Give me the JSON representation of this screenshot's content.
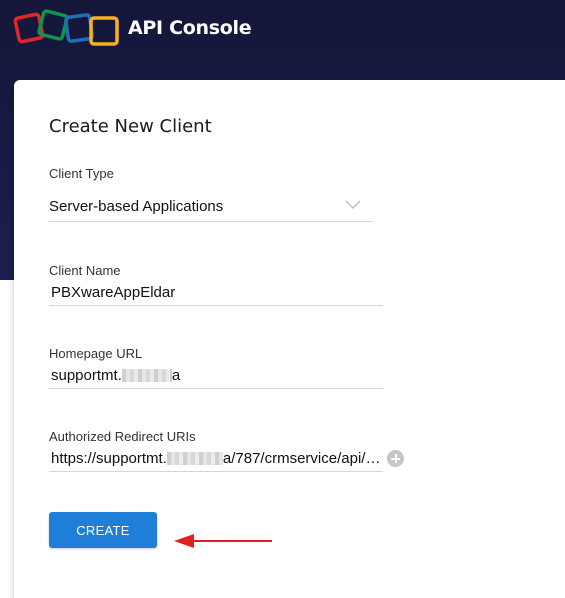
{
  "header": {
    "title": "API Console",
    "logo_icon": "zoho-logo-icon",
    "logo_colors": [
      "#e42527",
      "#089949",
      "#226db4",
      "#f9b21d"
    ]
  },
  "form": {
    "title": "Create New Client",
    "client_type": {
      "label": "Client Type",
      "value": "Server-based Applications"
    },
    "client_name": {
      "label": "Client Name",
      "value": "PBXwareAppEldar"
    },
    "homepage_url": {
      "label": "Homepage URL",
      "value_prefix": "supportmt.",
      "value_suffix": "a"
    },
    "redirect_uri": {
      "label": "Authorized Redirect URIs",
      "value_prefix": "https://supportmt.",
      "value_suffix": "a/787/crmservice/api/…"
    },
    "create_label": "CREATE"
  },
  "annotation": {
    "arrow_color": "#e02020"
  },
  "colors": {
    "header_bg": "#14163a",
    "accent": "#1f7fd8"
  }
}
